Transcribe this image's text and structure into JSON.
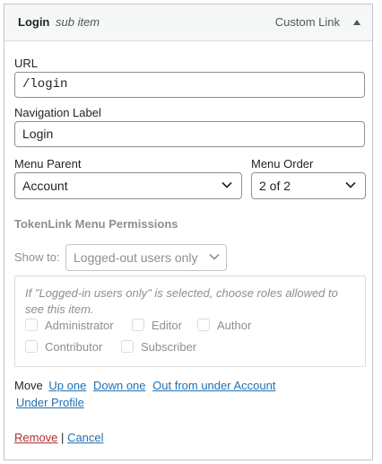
{
  "item": {
    "title": "Login",
    "subtitle": "sub item",
    "type": "Custom Link"
  },
  "url": {
    "label": "URL",
    "value": "/login"
  },
  "nav_label": {
    "label": "Navigation Label",
    "value": "Login"
  },
  "menu_parent": {
    "label": "Menu Parent",
    "selected": "Account"
  },
  "menu_order": {
    "label": "Menu Order",
    "selected": "2 of 2"
  },
  "permissions": {
    "heading": "TokenLink Menu Permissions",
    "show_to_label": "Show to:",
    "show_to_selected": "Logged-out users only",
    "hint": "If \"Logged-in users only\" is selected, choose roles allowed to see this item.",
    "roles": [
      "Administrator",
      "Editor",
      "Author",
      "Contributor",
      "Subscriber"
    ]
  },
  "move": {
    "label": "Move",
    "up_one": "Up one",
    "down_one": "Down one",
    "out_from_under": "Out from under Account",
    "under_profile": "Under Profile"
  },
  "actions": {
    "remove": "Remove",
    "separator": "|",
    "cancel": "Cancel"
  }
}
